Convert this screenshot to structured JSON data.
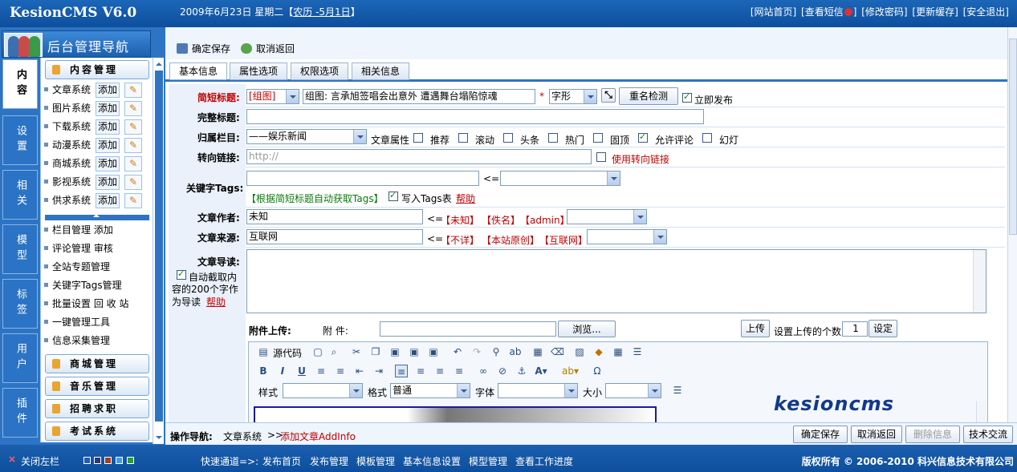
{
  "header": {
    "logo": "KesionCMS V6.0",
    "date_prefix": "2009年6月23日 星期二【",
    "lunar": "农历 -5月1日",
    "date_suffix": "】",
    "links": [
      "[网站首页]",
      "[查看短信",
      "]",
      "[修改密码]",
      "[更新缓存]",
      "[安全退出]"
    ]
  },
  "sidebar": {
    "title": "后台管理导航",
    "vtabs": [
      "内容",
      "设置",
      "相关",
      "模型",
      "标签",
      "用户",
      "插件"
    ],
    "content_group": "内容管理",
    "systems": [
      "文章系统",
      "图片系统",
      "下载系统",
      "动漫系统",
      "商城系统",
      "影视系统",
      "供求系统"
    ],
    "add_label": "添加",
    "links": [
      "栏目管理  添加",
      "评论管理  审核",
      "全站专题管理",
      "关键字Tags管理",
      "批量设置  回 收 站",
      "一键管理工具",
      "信息采集管理"
    ],
    "groups": [
      "商城管理",
      "音乐管理",
      "招聘求职",
      "考试系统"
    ]
  },
  "toolbar": {
    "save": "确定保存",
    "cancel": "取消返回"
  },
  "tabs": [
    "基本信息",
    "属性选项",
    "权限选项",
    "相关信息"
  ],
  "form": {
    "short_title_label": "简短标题:",
    "short_title_type": "[组图]",
    "short_title_value": "组图: 言承旭签唱会出意外 遭遇舞台塌陷惊魂",
    "required_star": "*",
    "font_style": "字形",
    "dup_check": "重名检测",
    "publish_now": "立即发布",
    "full_title_label": "完整标题:",
    "column_label": "归属栏目:",
    "column_value": "——娱乐新闻",
    "attr_label": "文章属性",
    "attrs": [
      "推荐",
      "滚动",
      "头条",
      "热门",
      "固顶",
      "允许评论",
      "幻灯"
    ],
    "attrs_checked": [
      false,
      false,
      false,
      false,
      false,
      true,
      false
    ],
    "redirect_label": "转向链接:",
    "redirect_placeholder": "http://",
    "use_redirect": "使用转向链接",
    "tags_label": "关键字Tags:",
    "tags_arrow": "<=",
    "tags_auto": "【根据简短标题自动获取Tags】",
    "tags_write": "写入Tags表",
    "help": "帮助",
    "author_label": "文章作者:",
    "author_value": "未知",
    "author_arrow": "<=",
    "author_opts": [
      "【未知】",
      "【佚名】",
      "【admin】"
    ],
    "source_label": "文章来源:",
    "source_value": "互联网",
    "source_arrow": "<=",
    "source_opts": [
      "【不详】",
      "【本站原创】",
      "【互联网】"
    ],
    "intro_label": "文章导读:",
    "intro_auto_1": "自动截取内",
    "intro_auto_2": "容的200个字作",
    "intro_auto_3": "为导读",
    "upload_label": "附件上传:",
    "attach_label": "附 件:",
    "browse": "浏览...",
    "upload_btn": "上传",
    "upload_count_label": "设置上传的个数",
    "upload_count": "1",
    "set_btn": "设定"
  },
  "editor": {
    "source": "源代码",
    "style_label": "样式",
    "format_label": "格式",
    "format_value": "普通",
    "font_label": "字体",
    "size_label": "大小"
  },
  "watermark": "kesioncms",
  "footer_nav": {
    "label": "操作导航:",
    "crumb1": "文章系统",
    "sep": ">>",
    "crumb2": "添加文章AddInfo",
    "buttons": [
      "确定保存",
      "取消返回",
      "删除信息",
      "技术交流"
    ]
  },
  "bottom": {
    "close": "关闭左栏",
    "quick": "快速通道=>:",
    "links": [
      "发布首页",
      "发布管理",
      "模板管理",
      "基本信息设置",
      "模型管理",
      "查看工作进度"
    ],
    "copyright": "版权所有 © 2006-2010 科兴信息技术有限公司"
  },
  "colors": {
    "header_blue": "#1c66b8",
    "required_red": "#c00000",
    "link_green": "#0a7a0a"
  }
}
